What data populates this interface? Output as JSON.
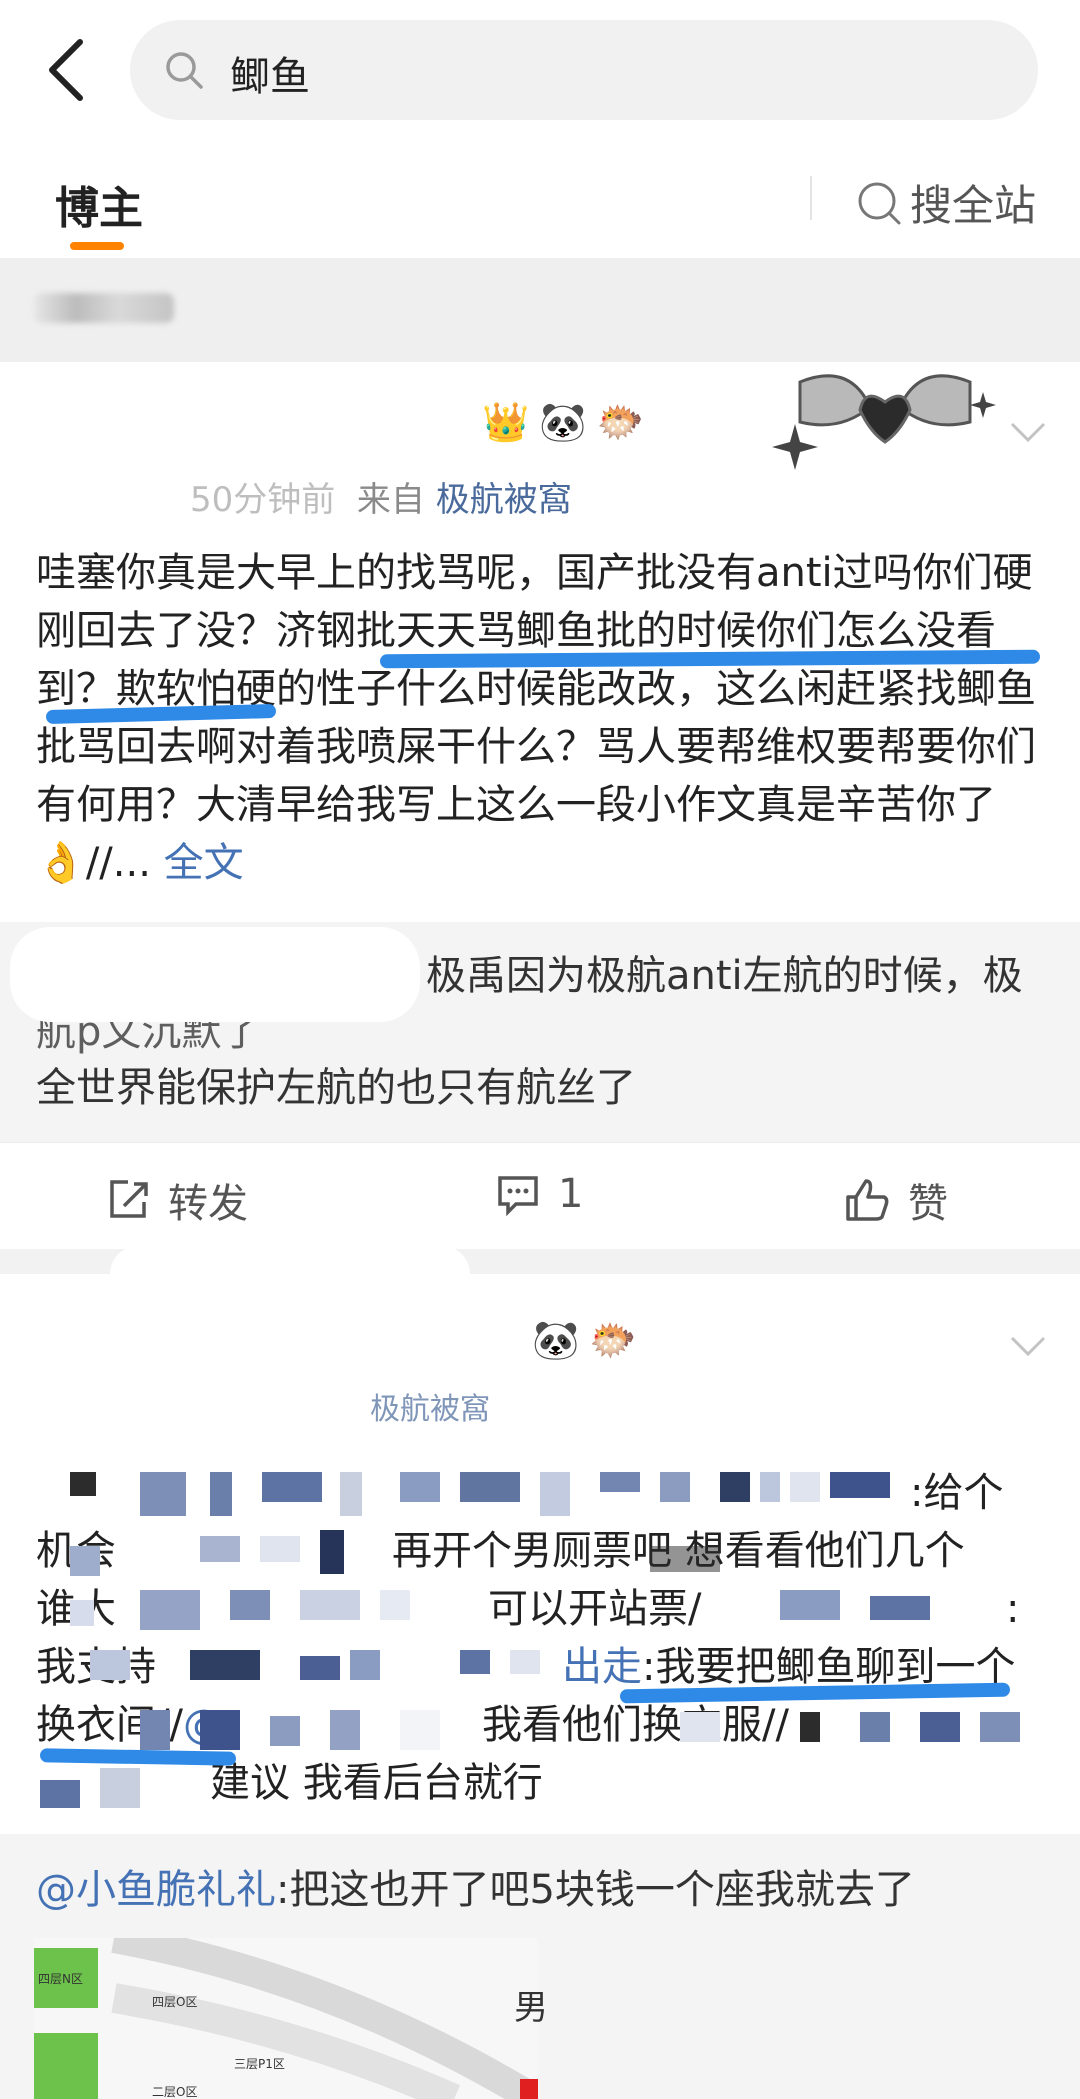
{
  "search": {
    "query": "鲫鱼"
  },
  "tabs": {
    "blogger": "博主",
    "site_search": "搜全站"
  },
  "post1": {
    "badges": [
      "👑",
      "🐼",
      "🐡"
    ],
    "meta_time": "50分钟前",
    "meta_from": "来自",
    "meta_source": "极航被窩",
    "text": "哇塞你真是大早上的找骂呢，国产批没有anti过吗你们硬刚回去了没？济钢批天天骂鲫鱼批的时候你们怎么没看到？欺软怕硬的性子什么时候能改改，这么闲赶紧找鲫鱼批骂回去啊对着我喷屎干什么？骂人要帮维权要帮要你们有何用？大清早给我写上这么一段小作文真是辛苦你了",
    "emoji": "👌",
    "tail": "//...",
    "full_text_link": "全文"
  },
  "repost1": {
    "line1": "极禹因为极航anti左航的时候，极",
    "line2": "航p文沉默了",
    "line3": "全世界能保护左航的也只有航丝了"
  },
  "actions": {
    "repost": "转发",
    "comment_count": "1",
    "like": "赞"
  },
  "post2": {
    "badges": [
      "🐼",
      "🐡"
    ],
    "meta_source": "极航被窩",
    "line1_end": ":给个",
    "line2_start": "机会",
    "line2_mid": "再开个男厕票吧 想看看他们几个",
    "line3_start": "谁大",
    "line3_mid": "可以开站票/",
    "line3_end": ":",
    "line4_start": "我支持",
    "line4_mid": "出走",
    "line4_end": ":我要把鲫鱼聊到一个",
    "line5_start": "换衣间//",
    "line5_at": "@",
    "line5_mid": "我看他们换衣服//",
    "line6_mid": "建议 我看后台就行"
  },
  "repost2": {
    "mention": "@小鱼脆礼礼",
    "text": ":把这也开了吧5块钱一个座我就去了",
    "map_labels": [
      "四层N区",
      "四层O区",
      "三层P1区",
      "二层O区"
    ],
    "side_char": "男"
  },
  "colors": {
    "accent": "#ff8200",
    "link": "#4472b4",
    "highlight": "#2e8ae6"
  }
}
